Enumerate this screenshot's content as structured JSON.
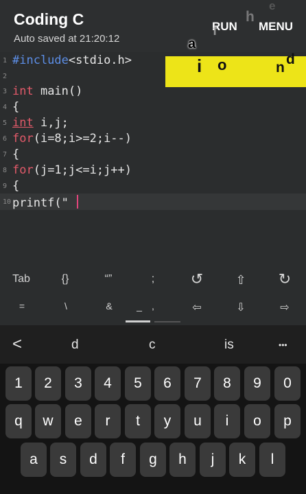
{
  "header": {
    "title": "Coding C",
    "subtitle": "Auto saved at 21:20:12",
    "run_label": "RUN",
    "menu_label": "MENU"
  },
  "overlay_letters": {
    "a": "a",
    "f": "f",
    "h": "h",
    "e": "e",
    "i": "i",
    "o": "o",
    "n": "n",
    "d": "d"
  },
  "colors": {
    "banner": "#ede418",
    "keyword_blue": "#5d8fe8",
    "keyword_red": "#e35a6a",
    "cursor": "#e0457b"
  },
  "editor": {
    "lines": [
      {
        "num": "1",
        "pre": "",
        "kw": "#include",
        "post": "<stdio.h>"
      },
      {
        "num": "2",
        "pre": "",
        "kw": "",
        "post": ""
      },
      {
        "num": "3",
        "pre": "",
        "kw": "int",
        "post": " main()"
      },
      {
        "num": "4",
        "pre": "",
        "kw": "",
        "post": "{"
      },
      {
        "num": "5",
        "pre": "",
        "kw": "int",
        "post": " i,j;"
      },
      {
        "num": "6",
        "pre": "",
        "kw": "for",
        "post": "(i=8;i>=2;i--)"
      },
      {
        "num": "7",
        "pre": "",
        "kw": "",
        "post": "{"
      },
      {
        "num": "8",
        "pre": "",
        "kw": "for",
        "post": "(j=1;j<=i;j++)"
      },
      {
        "num": "9",
        "pre": "",
        "kw": "",
        "post": "{"
      },
      {
        "num": "10",
        "pre": "",
        "kw": "",
        "post": "printf(\" "
      }
    ]
  },
  "symbol_bar": {
    "row1": [
      "Tab",
      "{}",
      "“”",
      ";",
      "↺",
      "⇧",
      "↻"
    ],
    "row2": [
      "=",
      "\\",
      "&",
      "_",
      ",",
      "⇦",
      "⇩",
      "⇨"
    ]
  },
  "suggestions": {
    "back": "<",
    "items": [
      "d",
      "c",
      "is"
    ],
    "more": "•••"
  },
  "keyboard": {
    "row1": [
      "1",
      "2",
      "3",
      "4",
      "5",
      "6",
      "7",
      "8",
      "9",
      "0"
    ],
    "row2": [
      "q",
      "w",
      "e",
      "r",
      "t",
      "y",
      "u",
      "i",
      "o",
      "p"
    ],
    "row3": [
      "a",
      "s",
      "d",
      "f",
      "g",
      "h",
      "j",
      "k",
      "l"
    ]
  }
}
